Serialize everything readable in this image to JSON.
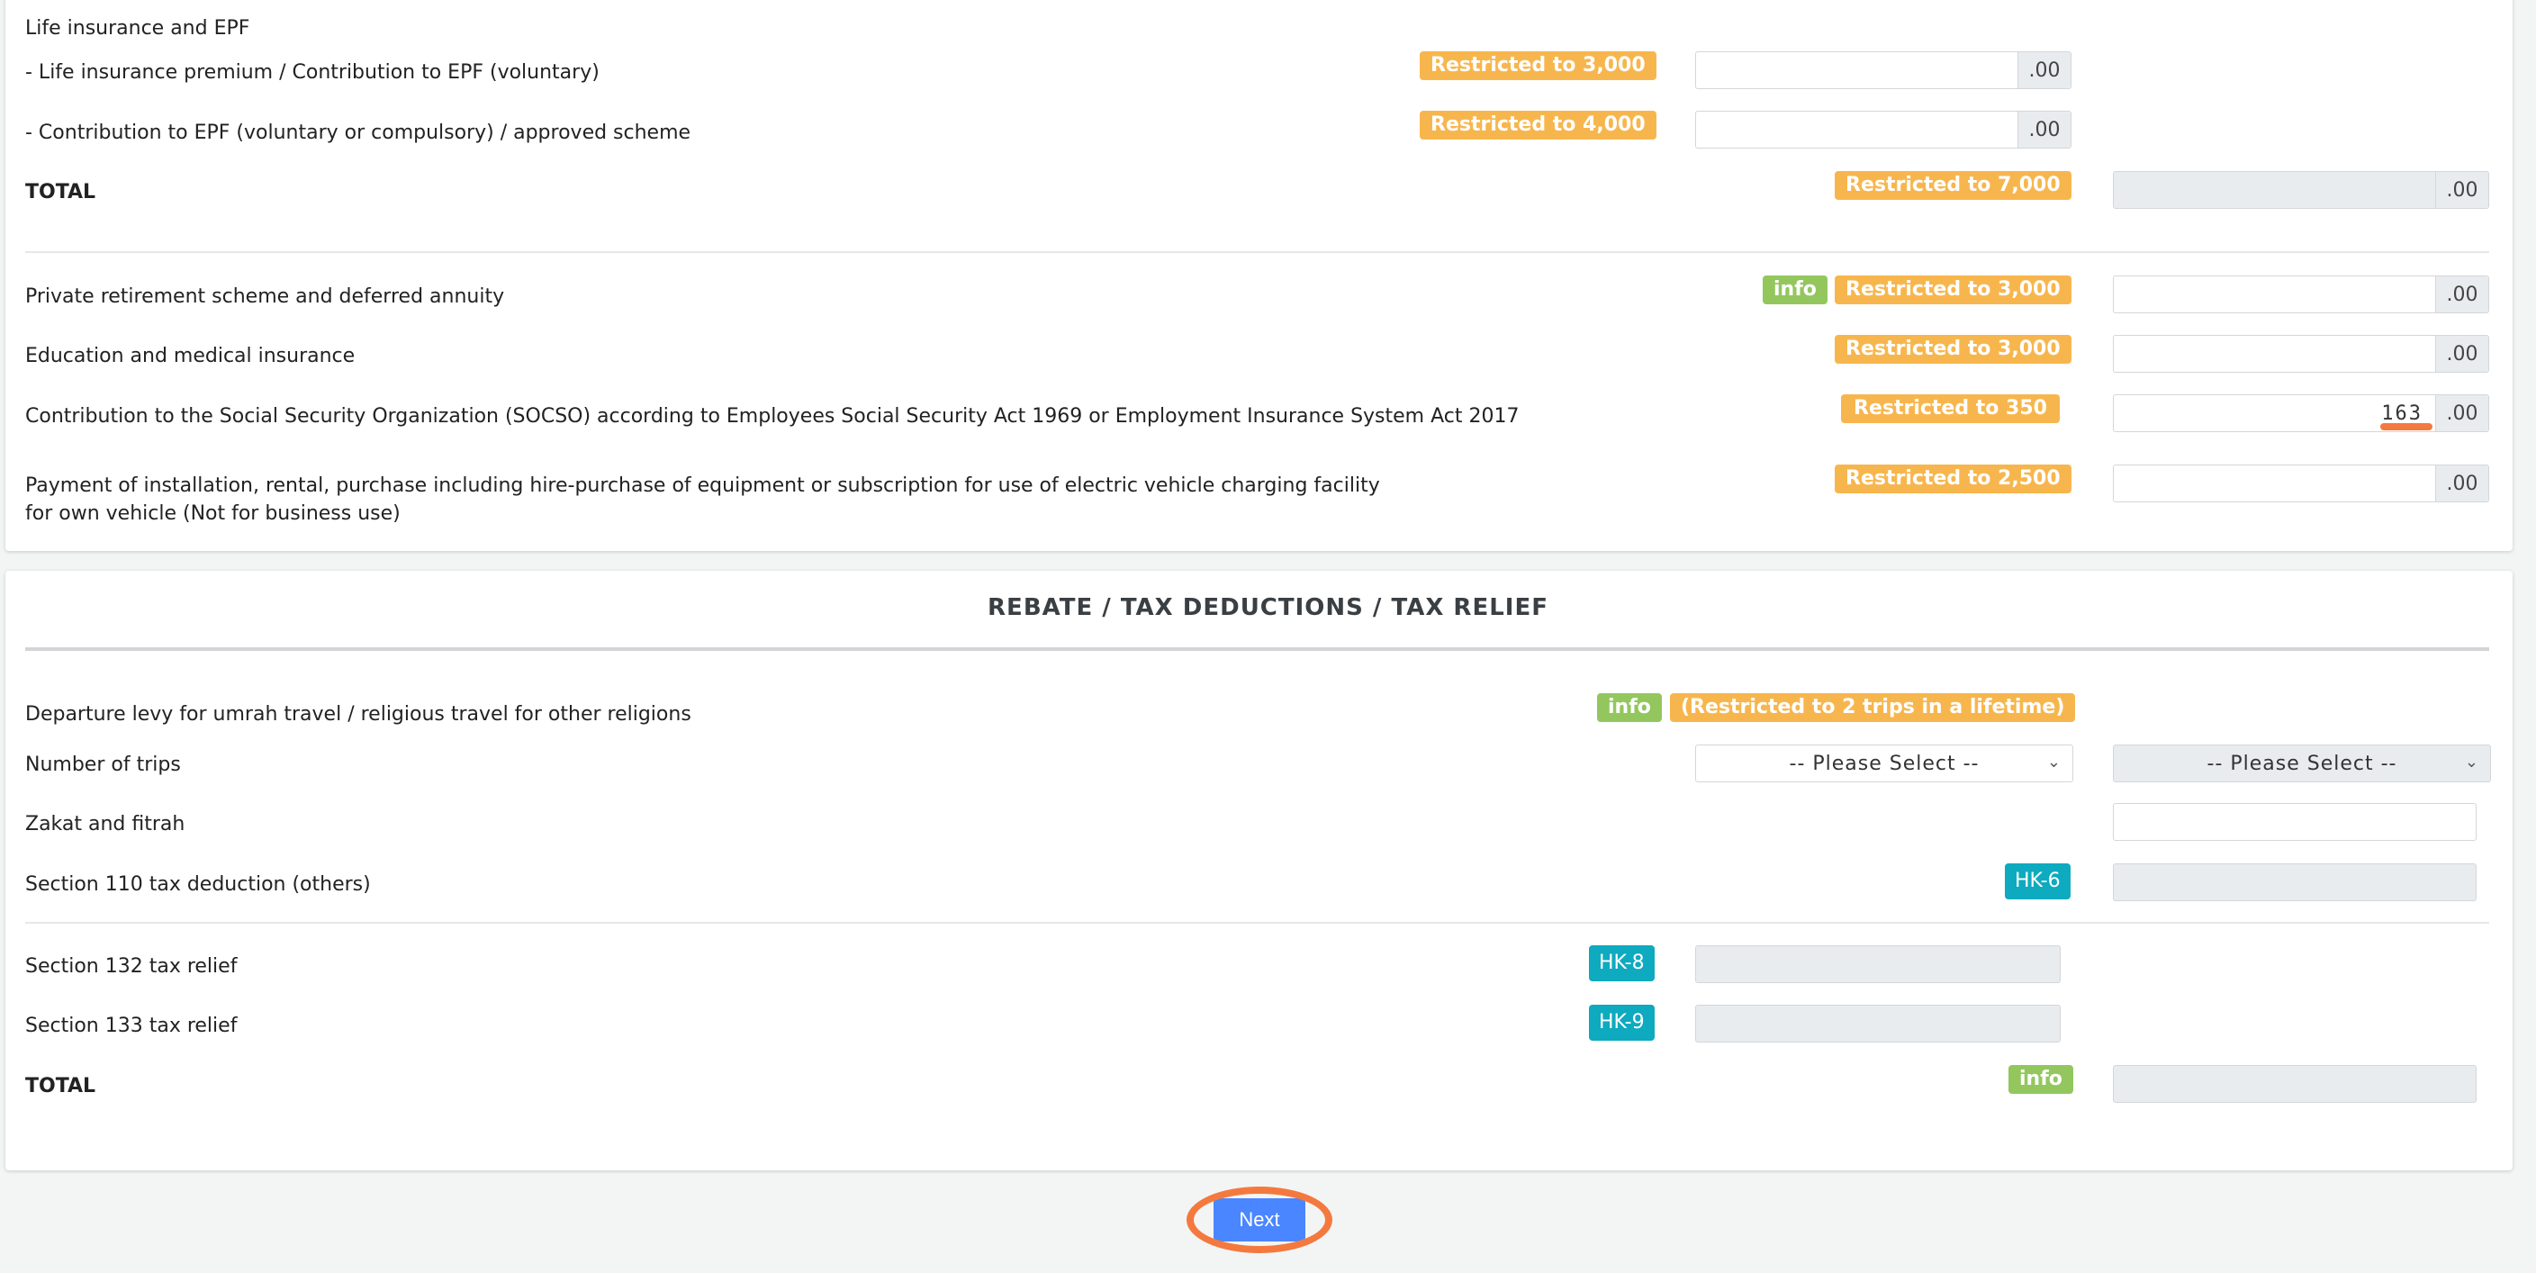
{
  "relief": {
    "life_insurance_heading": "Life insurance and EPF",
    "life_insurance_premium": {
      "label": "- Life insurance premium / Contribution to EPF (voluntary)",
      "badge": "Restricted to 3,000",
      "value": "",
      "suffix": ".00"
    },
    "epf_contribution": {
      "label": "- Contribution to EPF (voluntary or compulsory) / approved scheme",
      "badge": "Restricted to 4,000",
      "value": "",
      "suffix": ".00"
    },
    "life_total": {
      "label": "TOTAL",
      "badge": "Restricted to 7,000",
      "value": "",
      "suffix": ".00"
    },
    "private_retirement": {
      "label": "Private retirement scheme and deferred annuity",
      "info": "info",
      "badge": "Restricted to 3,000",
      "value": "",
      "suffix": ".00"
    },
    "education_medical": {
      "label": "Education and medical insurance",
      "badge": "Restricted to 3,000",
      "value": "",
      "suffix": ".00"
    },
    "socso": {
      "label": "Contribution to the Social Security Organization (SOCSO) according to Employees Social Security Act 1969 or Employment Insurance System Act 2017",
      "badge": "Restricted to 350",
      "value": "163",
      "suffix": ".00"
    },
    "ev_charging": {
      "label_line1": "Payment of installation, rental, purchase including hire-purchase of equipment or subscription for use of electric vehicle charging facility",
      "label_line2": "for own vehicle (Not for business use)",
      "badge": "Restricted to 2,500",
      "value": "",
      "suffix": ".00"
    }
  },
  "rebate": {
    "title": "REBATE / TAX DEDUCTIONS / TAX RELIEF",
    "departure_levy": {
      "label": "Departure levy for umrah travel / religious travel for other religions",
      "info": "info",
      "badge": "(Restricted to 2 trips in a lifetime)"
    },
    "trips": {
      "label": "Number of trips",
      "select1": "-- Please Select --",
      "select2": "-- Please Select --"
    },
    "zakat": {
      "label": "Zakat and fitrah",
      "value": ""
    },
    "section110": {
      "label": "Section 110 tax deduction (others)",
      "badge": "HK-6"
    },
    "section132": {
      "label": "Section 132 tax relief",
      "badge": "HK-8"
    },
    "section133": {
      "label": "Section 133 tax relief",
      "badge": "HK-9"
    },
    "total": {
      "label": "TOTAL",
      "info": "info"
    }
  },
  "actions": {
    "next_label": "Next"
  },
  "colors": {
    "restricted_badge": "#f7b64d",
    "info_badge": "#93c75e",
    "hk_badge": "#0eaabf",
    "next_button": "#4a86ff",
    "highlight": "#f4793f"
  }
}
